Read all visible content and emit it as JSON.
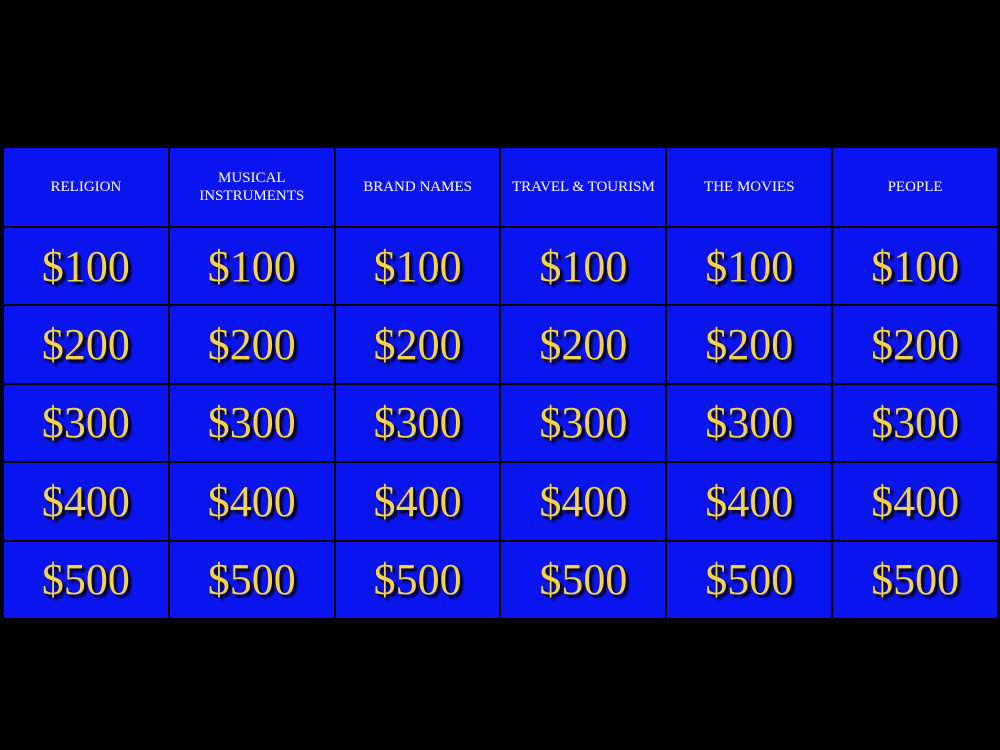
{
  "board": {
    "categories": [
      "RELIGION",
      "MUSICAL\nINSTRUMENTS",
      "BRAND NAMES",
      "TRAVEL & TOURISM",
      "THE MOVIES",
      "PEOPLE"
    ],
    "values": [
      "$100",
      "$200",
      "$300",
      "$400",
      "$500"
    ]
  },
  "colors": {
    "background": "#000000",
    "cell": "#0a14f0",
    "category_text": "#ffffff",
    "value_text": "#f5d24a"
  }
}
